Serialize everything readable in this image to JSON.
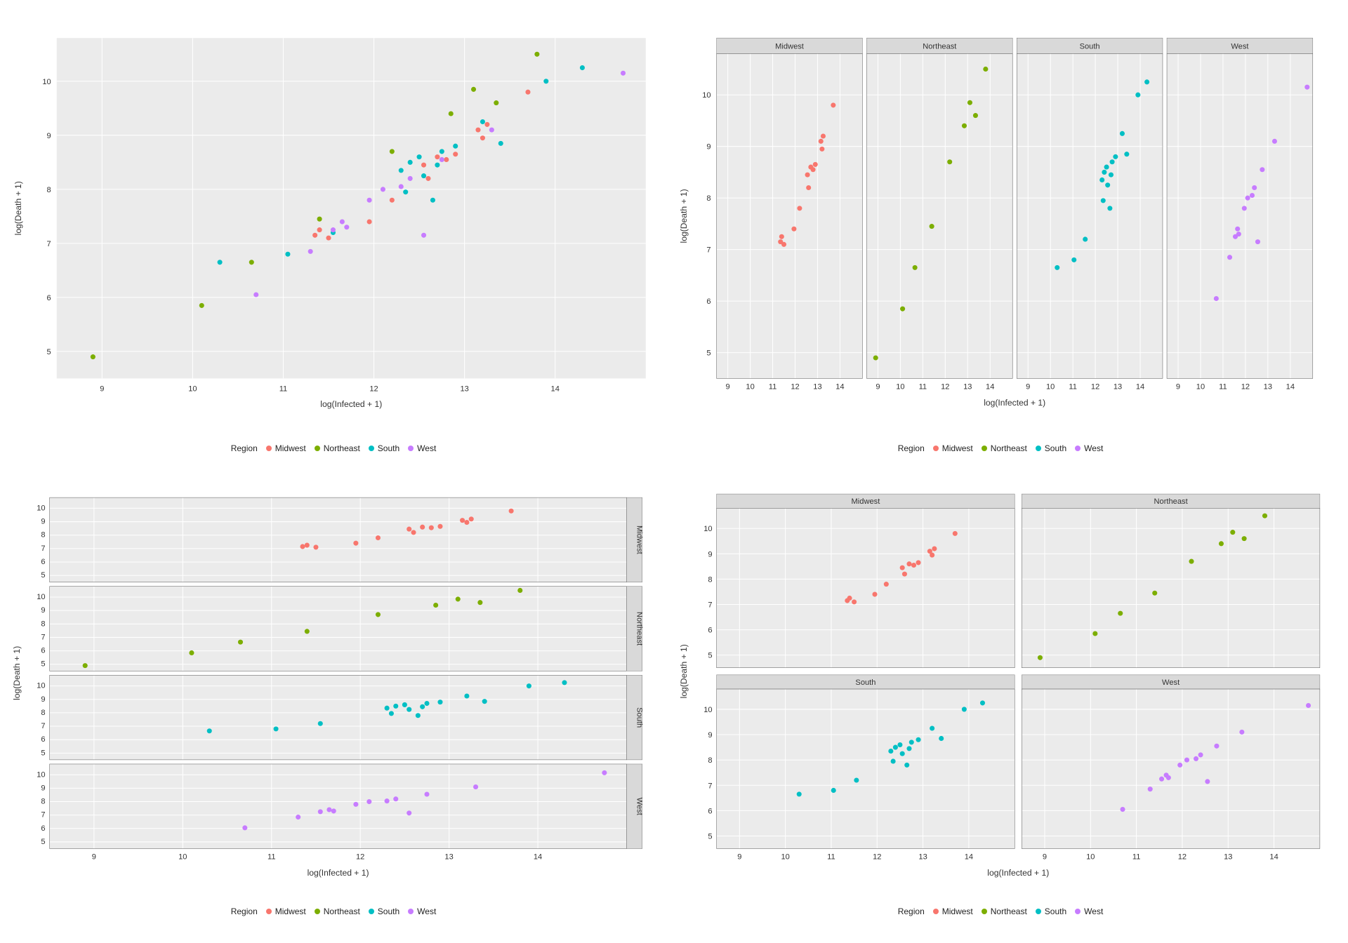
{
  "axes": {
    "xlabel": "log(Infected + 1)",
    "ylabel": "log(Death + 1)",
    "x_ticks": [
      9,
      10,
      11,
      12,
      13,
      14
    ],
    "y_ticks": [
      5,
      6,
      7,
      8,
      9,
      10
    ],
    "xlim": [
      8.5,
      15.0
    ],
    "ylim": [
      4.5,
      10.8
    ]
  },
  "legend": {
    "title": "Region",
    "items": [
      {
        "label": "Midwest",
        "color": "#F8766D"
      },
      {
        "label": "Northeast",
        "color": "#7CAE00"
      },
      {
        "label": "South",
        "color": "#00BFC4"
      },
      {
        "label": "West",
        "color": "#C77CFF"
      }
    ]
  },
  "facet_labels": {
    "midwest": "Midwest",
    "northeast": "Northeast",
    "south": "South",
    "west": "West"
  },
  "chart_data": {
    "type": "scatter",
    "xlabel": "log(Infected + 1)",
    "ylabel": "log(Death + 1)",
    "xlim": [
      8.5,
      15.0
    ],
    "ylim": [
      4.5,
      10.8
    ],
    "series": [
      {
        "name": "Midwest",
        "color": "#F8766D",
        "points": [
          [
            11.35,
            7.15
          ],
          [
            11.4,
            7.25
          ],
          [
            11.5,
            7.1
          ],
          [
            11.95,
            7.4
          ],
          [
            12.2,
            7.8
          ],
          [
            12.55,
            8.45
          ],
          [
            12.6,
            8.2
          ],
          [
            12.7,
            8.6
          ],
          [
            12.8,
            8.55
          ],
          [
            12.9,
            8.65
          ],
          [
            13.15,
            9.1
          ],
          [
            13.2,
            8.95
          ],
          [
            13.25,
            9.2
          ],
          [
            13.7,
            9.8
          ]
        ]
      },
      {
        "name": "Northeast",
        "color": "#7CAE00",
        "points": [
          [
            8.9,
            4.9
          ],
          [
            10.1,
            5.85
          ],
          [
            10.65,
            6.65
          ],
          [
            11.4,
            7.45
          ],
          [
            12.2,
            8.7
          ],
          [
            12.85,
            9.4
          ],
          [
            13.1,
            9.85
          ],
          [
            13.35,
            9.6
          ],
          [
            13.8,
            10.5
          ]
        ]
      },
      {
        "name": "South",
        "color": "#00BFC4",
        "points": [
          [
            10.3,
            6.65
          ],
          [
            11.05,
            6.8
          ],
          [
            11.55,
            7.2
          ],
          [
            12.3,
            8.35
          ],
          [
            12.35,
            7.95
          ],
          [
            12.4,
            8.5
          ],
          [
            12.5,
            8.6
          ],
          [
            12.55,
            8.25
          ],
          [
            12.65,
            7.8
          ],
          [
            12.7,
            8.45
          ],
          [
            12.75,
            8.7
          ],
          [
            12.9,
            8.8
          ],
          [
            13.2,
            9.25
          ],
          [
            13.4,
            8.85
          ],
          [
            13.9,
            10.0
          ],
          [
            14.3,
            10.25
          ]
        ]
      },
      {
        "name": "West",
        "color": "#C77CFF",
        "points": [
          [
            10.7,
            6.05
          ],
          [
            11.3,
            6.85
          ],
          [
            11.55,
            7.25
          ],
          [
            11.65,
            7.4
          ],
          [
            11.7,
            7.3
          ],
          [
            11.95,
            7.8
          ],
          [
            12.1,
            8.0
          ],
          [
            12.3,
            8.05
          ],
          [
            12.4,
            8.2
          ],
          [
            12.55,
            7.15
          ],
          [
            12.75,
            8.55
          ],
          [
            13.3,
            9.1
          ],
          [
            14.75,
            10.15
          ]
        ]
      }
    ],
    "panels_description": "Top-left: all regions overlaid. Top-right: faceted into 4 columns by Region (facet_grid cols). Bottom-left: faceted into 4 rows by Region (facet_grid rows, strips on right). Bottom-right: facet_wrap 2x2 by Region."
  }
}
